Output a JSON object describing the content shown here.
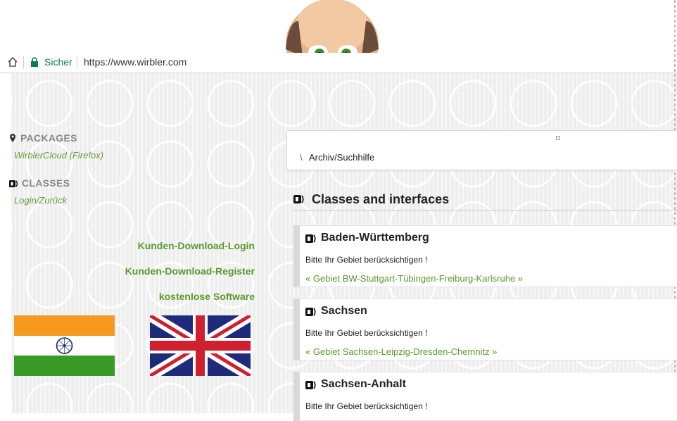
{
  "browser": {
    "secure_label": "Sicher",
    "url": "https://www.wirbler.com"
  },
  "sidebar": {
    "packages_heading": "PACKAGES",
    "packages_link": "WirblerCloud (Firefox)",
    "classes_heading": "CLASSES",
    "classes_link": "Login/Zurück"
  },
  "links": {
    "download_login": "Kunden-Download-Login",
    "download_register": "Kunden-Download-Register",
    "free_software": "kostenlose Software"
  },
  "breadcrumb": {
    "separator": "\\",
    "item": "Archiv/Suchhilfe"
  },
  "section": {
    "title": "Classes and interfaces"
  },
  "regions": [
    {
      "title": "Baden-Württemberg",
      "description": "Bitte Ihr Gebiet berücksichtigen !",
      "link": "« Gebiet BW-Stuttgart-Tübingen-Freiburg-Karlsruhe »"
    },
    {
      "title": "Sachsen",
      "description": "Bitte Ihr Gebiet berücksichtigen !",
      "link": "« Gebiet Sachsen-Leipzig-Dresden-Chemnitz »"
    },
    {
      "title": "Sachsen-Anhalt",
      "description": "Bitte Ihr Gebiet berücksichtigen !",
      "link": ""
    }
  ],
  "colors": {
    "link_green": "#5a9a2e",
    "secure_green": "#0b8043"
  },
  "icons": [
    "home-icon",
    "lock-icon",
    "map-pin-icon",
    "class-icon",
    "mascot-face",
    "india-flag",
    "uk-flag"
  ]
}
